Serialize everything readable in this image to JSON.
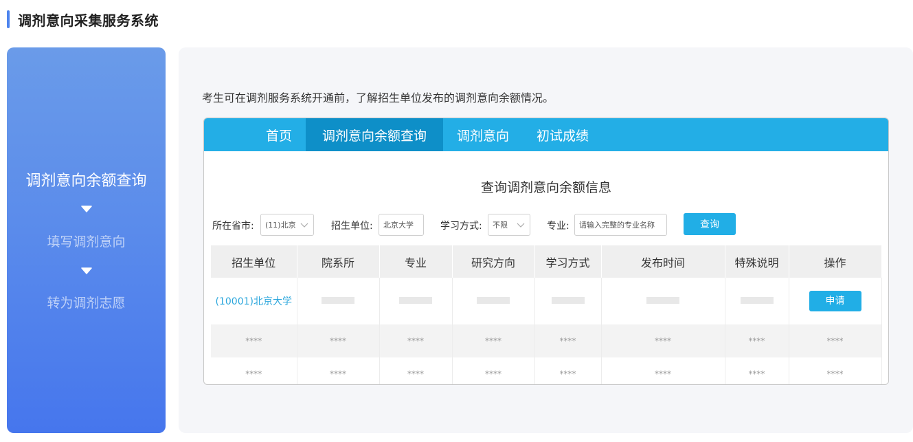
{
  "page": {
    "title": "调剂意向采集服务系统"
  },
  "steps": {
    "active": "调剂意向余额查询",
    "second": "填写调剂意向",
    "third": "转为调剂志愿"
  },
  "content": {
    "description": "考生可在调剂服务系统开通前，了解招生单位发布的调剂意向余额情况。",
    "nav": [
      "首页",
      "调剂意向余额查询",
      "调剂意向",
      "初试成绩"
    ],
    "nav_active_index": 1,
    "query_title": "查询调剂意向余额信息",
    "filters": {
      "province_label": "所在省市:",
      "province_value": "(11)北京",
      "unit_label": "招生单位:",
      "unit_value": "北京大学",
      "mode_label": "学习方式:",
      "mode_value": "不限",
      "major_label": "专业:",
      "major_placeholder": "请输入完整的专业名称",
      "query_button": "查询"
    },
    "table": {
      "headers": [
        "招生单位",
        "院系所",
        "专业",
        "研究方向",
        "学习方式",
        "发布时间",
        "特殊说明",
        "操作"
      ],
      "row1_unit": "(10001)北京大学",
      "apply_button": "申请",
      "mask": "****"
    }
  },
  "colors": {
    "accent": "#23aee6",
    "nav_active": "#0e8fc8",
    "panel_gradient_top": "#6a9be9",
    "panel_gradient_bottom": "#4676ed",
    "link": "#2aa6dc"
  },
  "icons": {
    "step_arrow": "caret-down-icon",
    "select_arrow": "chevron-down-icon"
  }
}
